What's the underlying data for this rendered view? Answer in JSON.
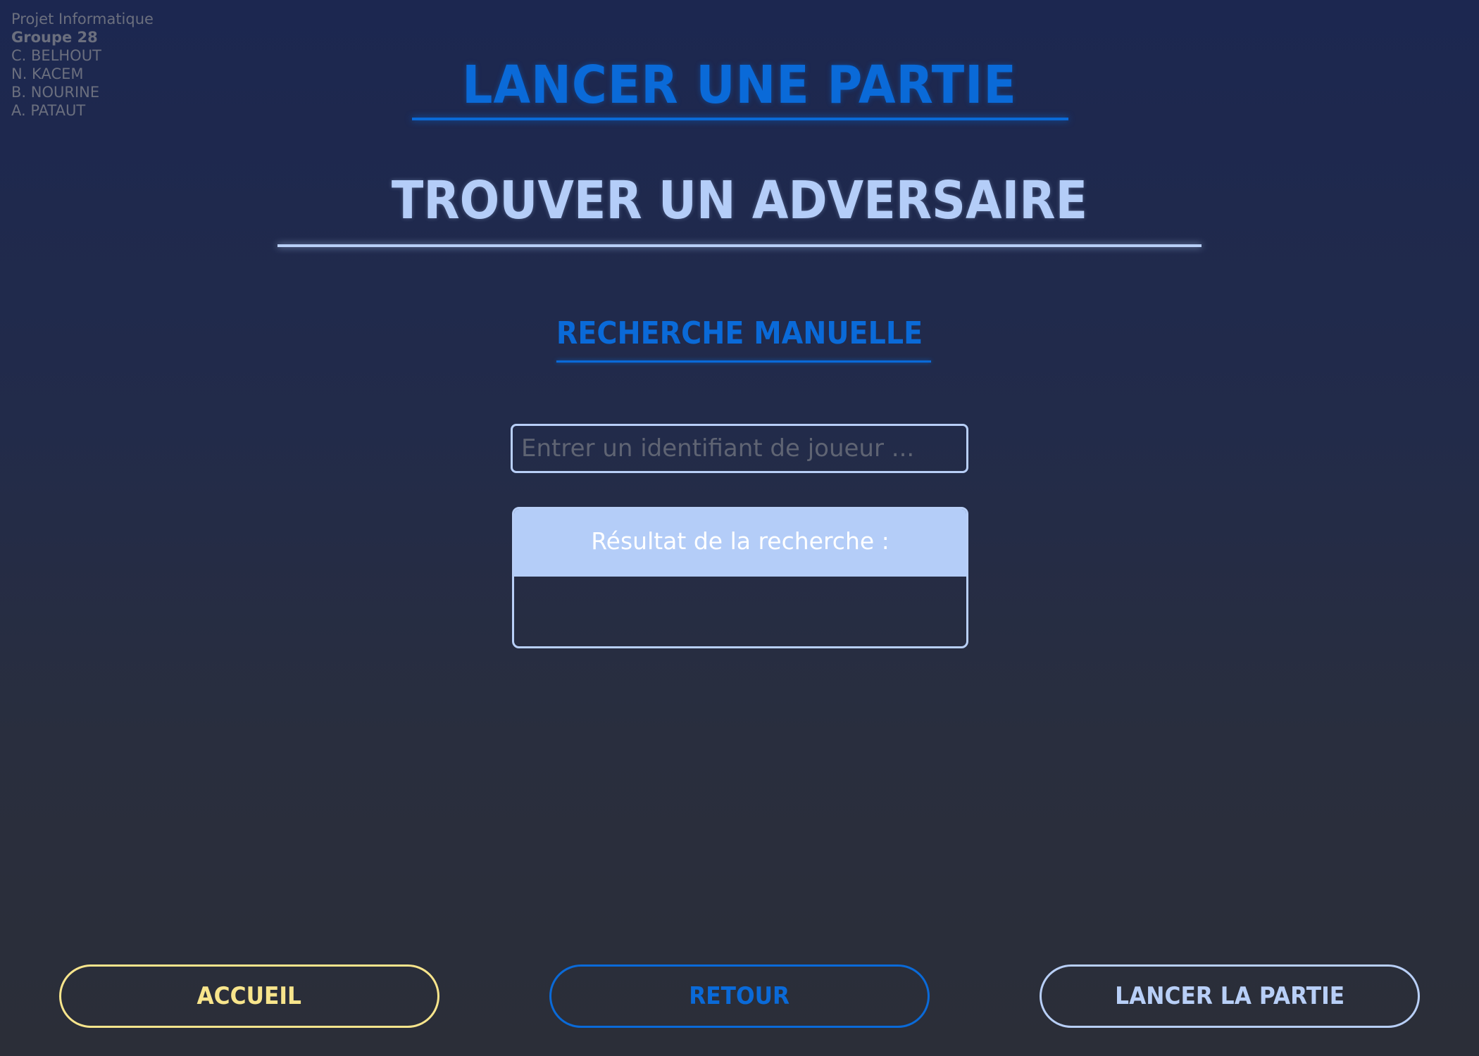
{
  "credits": {
    "project": "Projet Informatique",
    "group": "Groupe 28",
    "members": [
      "C. BELHOUT",
      "N. KACEM",
      "B. NOURINE",
      "A. PATAUT"
    ]
  },
  "header": {
    "title": "LANCER UNE PARTIE",
    "subtitle": "TROUVER UN ADVERSAIRE"
  },
  "search": {
    "section_title": "RECHERCHE MANUELLE",
    "placeholder": "Entrer un identifiant de joueur ...",
    "value": "",
    "result_label": "Résultat de la recherche :",
    "results": []
  },
  "footer": {
    "home_label": "ACCUEIL",
    "back_label": "RETOUR",
    "launch_label": "LANCER LA PARTIE"
  },
  "colors": {
    "accent_blue": "#0a6ad8",
    "light_blue": "#b4cdf8",
    "yellow": "#f8e58c",
    "background_top": "#1c2750",
    "background_bottom": "#2b2e38"
  }
}
